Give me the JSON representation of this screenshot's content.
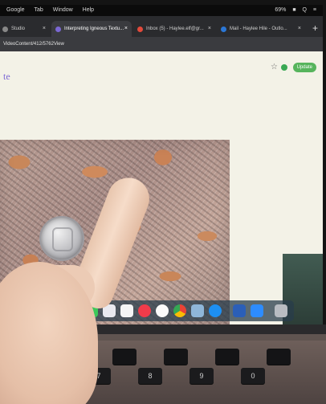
{
  "menubar": {
    "items": [
      "Google",
      "Tab",
      "Window",
      "Help"
    ],
    "status": [
      "69%",
      "■",
      "Q",
      "≡"
    ]
  },
  "browser": {
    "tabs": [
      {
        "label": "Studio",
        "active": false
      },
      {
        "label": "Interpreting Igneous Textu...",
        "active": true
      },
      {
        "label": "Inbox (5) - Haylee.elf@gr...",
        "active": false
      },
      {
        "label": "Mail - Haylee Hile - Outlo...",
        "active": false
      }
    ],
    "url": "VideoContent/412/5762View",
    "update_label": "Update",
    "page_title_fragment": "te"
  },
  "colors": {
    "active_tab": "#3a3b3f",
    "page_background": "#f3f2e7",
    "page_title": "#7b68d4",
    "update_button": "#56b45c",
    "rock_base": "#b99d93",
    "feldspar": "#c8875a"
  },
  "dock": {
    "icons": [
      "messages-icon",
      "photos-icon",
      "calendar-icon",
      "news-icon",
      "music-icon",
      "chrome-icon",
      "preview-icon",
      "app-store-icon",
      "word-icon",
      "zoom-icon",
      "trash-icon"
    ]
  },
  "keyboard": {
    "keys": [
      "7",
      "8",
      "9",
      "0"
    ]
  }
}
